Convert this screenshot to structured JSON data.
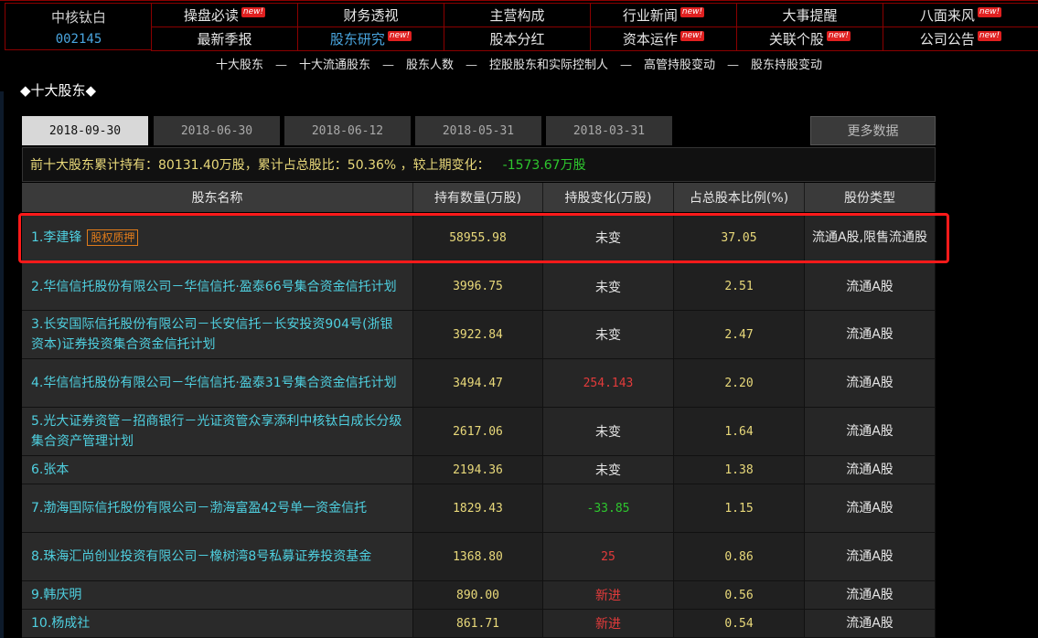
{
  "stock": {
    "name": "中核钛白",
    "code": "002145"
  },
  "nav": [
    {
      "label": "操盘必读",
      "new": true,
      "active": false
    },
    {
      "label": "财务透视",
      "new": false,
      "active": false
    },
    {
      "label": "主营构成",
      "new": false,
      "active": false
    },
    {
      "label": "行业新闻",
      "new": true,
      "active": false
    },
    {
      "label": "大事提醒",
      "new": false,
      "active": false
    },
    {
      "label": "八面来风",
      "new": true,
      "active": false
    },
    {
      "label": "最新季报",
      "new": false,
      "active": false
    },
    {
      "label": "股东研究",
      "new": true,
      "active": true
    },
    {
      "label": "股本分红",
      "new": false,
      "active": false
    },
    {
      "label": "资本运作",
      "new": true,
      "active": false
    },
    {
      "label": "关联个股",
      "new": true,
      "active": false
    },
    {
      "label": "公司公告",
      "new": true,
      "active": false
    }
  ],
  "badge_text": "new!",
  "subnav": [
    "十大股东",
    "十大流通股东",
    "股东人数",
    "控股股东和实际控制人",
    "高管持股变动",
    "股东持股变动"
  ],
  "subnav_sep": "—",
  "section_title": "◆十大股东◆",
  "tabs": [
    "2018-09-30",
    "2018-06-30",
    "2018-06-12",
    "2018-05-31",
    "2018-03-31"
  ],
  "more_label": "更多数据",
  "summary": {
    "text": "前十大股东累计持有：80131.40万股，累计占总股比：50.36% ，较上期变化：",
    "change": "-1573.67万股"
  },
  "table": {
    "headers": [
      "股东名称",
      "持有数量(万股)",
      "持股变化(万股)",
      "占总股本比例(%)",
      "股份类型"
    ],
    "rows": [
      {
        "name": "1.李建锋",
        "tag": "股权质押",
        "qty": "58955.98",
        "chg": "未变",
        "chg_type": "same",
        "pct": "37.05",
        "type": "流通A股,限售流通股"
      },
      {
        "name": "2.华信信托股份有限公司－华信信托·盈泰66号集合资金信托计划",
        "tag": "",
        "qty": "3996.75",
        "chg": "未变",
        "chg_type": "same",
        "pct": "2.51",
        "type": "流通A股"
      },
      {
        "name": "3.长安国际信托股份有限公司－长安信托－长安投资904号(浙银资本)证券投资集合资金信托计划",
        "tag": "",
        "qty": "3922.84",
        "chg": "未变",
        "chg_type": "same",
        "pct": "2.47",
        "type": "流通A股"
      },
      {
        "name": "4.华信信托股份有限公司－华信信托·盈泰31号集合资金信托计划",
        "tag": "",
        "qty": "3494.47",
        "chg": "254.143",
        "chg_type": "up",
        "pct": "2.20",
        "type": "流通A股"
      },
      {
        "name": "5.光大证券资管－招商银行－光证资管众享添利中核钛白成长分级集合资产管理计划",
        "tag": "",
        "qty": "2617.06",
        "chg": "未变",
        "chg_type": "same",
        "pct": "1.64",
        "type": "流通A股"
      },
      {
        "name": "6.张本",
        "tag": "",
        "qty": "2194.36",
        "chg": "未变",
        "chg_type": "same",
        "pct": "1.38",
        "type": "流通A股"
      },
      {
        "name": "7.渤海国际信托股份有限公司－渤海富盈42号单一资金信托",
        "tag": "",
        "qty": "1829.43",
        "chg": "-33.85",
        "chg_type": "down",
        "pct": "1.15",
        "type": "流通A股"
      },
      {
        "name": "8.珠海汇尚创业投资有限公司－橡树湾8号私募证券投资基金",
        "tag": "",
        "qty": "1368.80",
        "chg": "25",
        "chg_type": "up",
        "pct": "0.86",
        "type": "流通A股"
      },
      {
        "name": "9.韩庆明",
        "tag": "",
        "qty": "890.00",
        "chg": "新进",
        "chg_type": "new",
        "pct": "0.56",
        "type": "流通A股"
      },
      {
        "name": "10.杨成社",
        "tag": "",
        "qty": "861.71",
        "chg": "新进",
        "chg_type": "new",
        "pct": "0.54",
        "type": "流通A股"
      }
    ]
  }
}
